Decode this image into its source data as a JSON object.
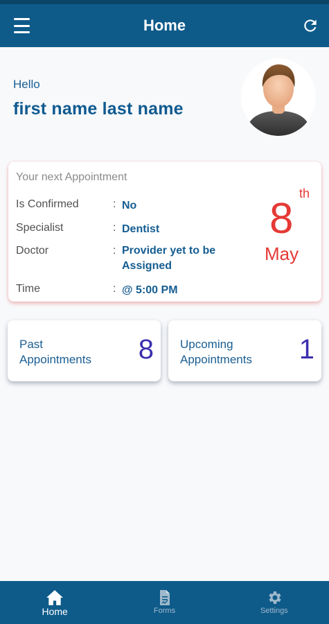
{
  "header": {
    "title": "Home"
  },
  "greeting": {
    "hello": "Hello",
    "name": "first name last name"
  },
  "next_appointment": {
    "heading": "Your next Appointment",
    "rows": [
      {
        "label": "Is Confirmed",
        "colon": ":",
        "value": "No"
      },
      {
        "label": "Specialist",
        "colon": ":",
        "value": "Dentist"
      },
      {
        "label": "Doctor",
        "colon": ":",
        "value": "Provider yet to be Assigned"
      },
      {
        "label": "Time",
        "colon": ":",
        "value": "@ 5:00 PM"
      }
    ],
    "day": "8",
    "day_suffix": "th",
    "month": "May"
  },
  "summary": {
    "past": {
      "label": "Past Appointments",
      "count": "8"
    },
    "upcoming": {
      "label": "Upcoming Appointments",
      "count": "1"
    }
  },
  "bottom_nav": [
    {
      "label": "Home",
      "icon": "home-icon",
      "active": true
    },
    {
      "label": "Forms",
      "icon": "forms-icon",
      "active": false
    },
    {
      "label": "Settings",
      "icon": "gear-icon",
      "active": false
    }
  ],
  "colors": {
    "header": "#0e5b8a",
    "accent_text": "#155d91",
    "date": "#e53935",
    "count": "#3b2fae"
  }
}
